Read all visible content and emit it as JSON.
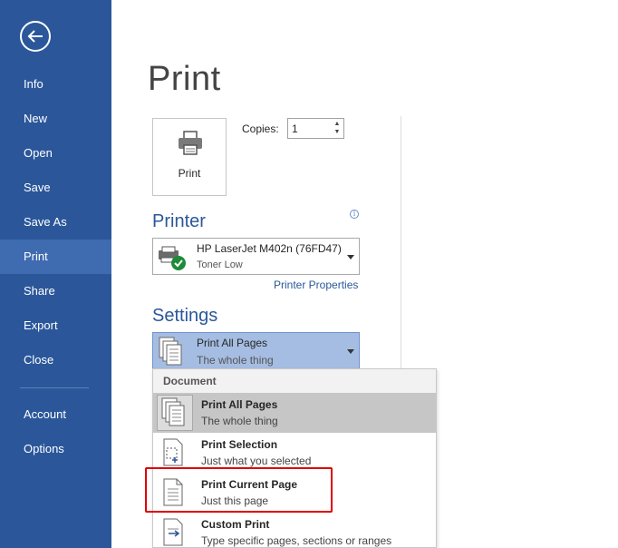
{
  "sidebar": {
    "items": [
      {
        "label": "Info"
      },
      {
        "label": "New"
      },
      {
        "label": "Open"
      },
      {
        "label": "Save"
      },
      {
        "label": "Save As"
      },
      {
        "label": "Print"
      },
      {
        "label": "Share"
      },
      {
        "label": "Export"
      },
      {
        "label": "Close"
      },
      {
        "label": "Account"
      },
      {
        "label": "Options"
      }
    ],
    "active": "Print"
  },
  "main": {
    "title": "Print",
    "print_button_label": "Print",
    "copies_label": "Copies:",
    "copies_value": "1",
    "printer_heading": "Printer",
    "printer_name": "HP LaserJet M402n (76FD47)",
    "printer_status": "Toner Low",
    "printer_properties_link": "Printer Properties",
    "settings_heading": "Settings",
    "settings_selected_title": "Print All Pages",
    "settings_selected_sub": "The whole thing"
  },
  "dropdown": {
    "header": "Document",
    "options": [
      {
        "title": "Print All Pages",
        "sub": "The whole thing"
      },
      {
        "title": "Print Selection",
        "sub": "Just what you selected"
      },
      {
        "title": "Print Current Page",
        "sub": "Just this page"
      },
      {
        "title": "Custom Print",
        "sub": "Type specific pages, sections or ranges"
      }
    ]
  },
  "colors": {
    "sidebar": "#2b579a",
    "sidebar_active": "#3f6bb0",
    "accent": "#2b579a",
    "settings_selected_bg": "#a5bde2",
    "highlight": "#e00000"
  }
}
